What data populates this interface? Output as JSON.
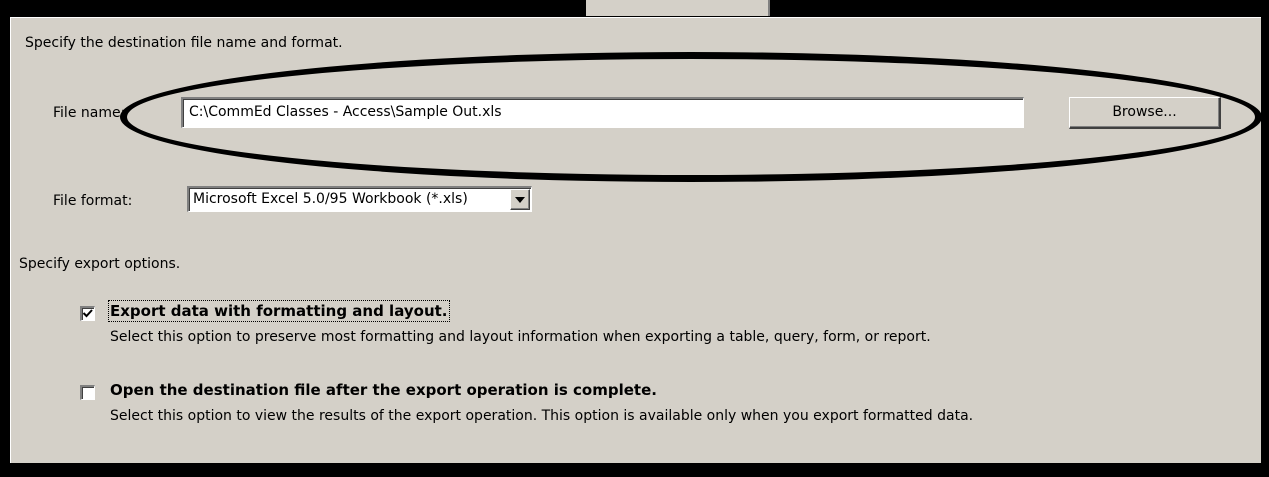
{
  "dialog": {
    "destination_heading": "Specify the destination file name and format.",
    "file_name_label": "File name:",
    "file_name_value": "C:\\CommEd Classes - Access\\Sample Out.xls",
    "browse_label": "Browse...",
    "file_format_label": "File format:",
    "file_format_value": "Microsoft Excel 5.0/95 Workbook (*.xls)",
    "options_heading": "Specify export options.",
    "options": [
      {
        "label": "Export data with formatting and layout.",
        "description": "Select this option to preserve most formatting and layout information when exporting a table, query, form, or report.",
        "checked": true
      },
      {
        "label": "Open the destination file after the export operation is complete.",
        "description": "Select this option to view the results of the export operation. This option is available only when you export formatted data.",
        "checked": false
      }
    ]
  },
  "colors": {
    "dialog_bg": "#d4d0c8",
    "frame": "#000000",
    "annotation": "#000000"
  },
  "icons": [
    "dropdown-arrow-icon",
    "checkmark-icon"
  ]
}
